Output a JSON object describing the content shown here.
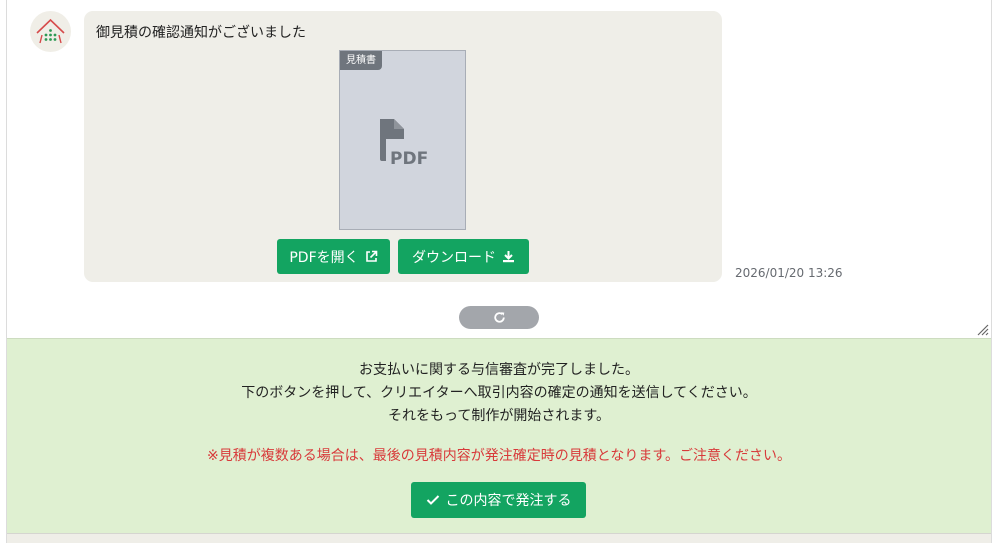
{
  "message": {
    "text": "御見積の確認通知がございました",
    "attachment_tag": "見積書",
    "file_type_label": "PDF",
    "open_label": "PDFを開く",
    "download_label": "ダウンロード",
    "timestamp": "2026/01/20 13:26"
  },
  "confirm": {
    "line1": "お支払いに関する与信審査が完了しました。",
    "line2": "下のボタンを押して、クリエイターへ取引内容の確定の通知を送信してください。",
    "line3": "それをもって制作が開始されます。",
    "warning": "※見積が複数ある場合は、最後の見積内容が発注確定時の見積となります。ご注意ください。",
    "order_label": "この内容で発注する"
  },
  "icons": {
    "open": "external-link-icon",
    "download": "download-icon",
    "refresh": "refresh-icon",
    "order": "check-icon"
  },
  "colors": {
    "accent_green": "#13a461",
    "panel_green": "#dff0d1",
    "warning_red": "#d83a3a",
    "bubble_bg": "#efeee8"
  }
}
